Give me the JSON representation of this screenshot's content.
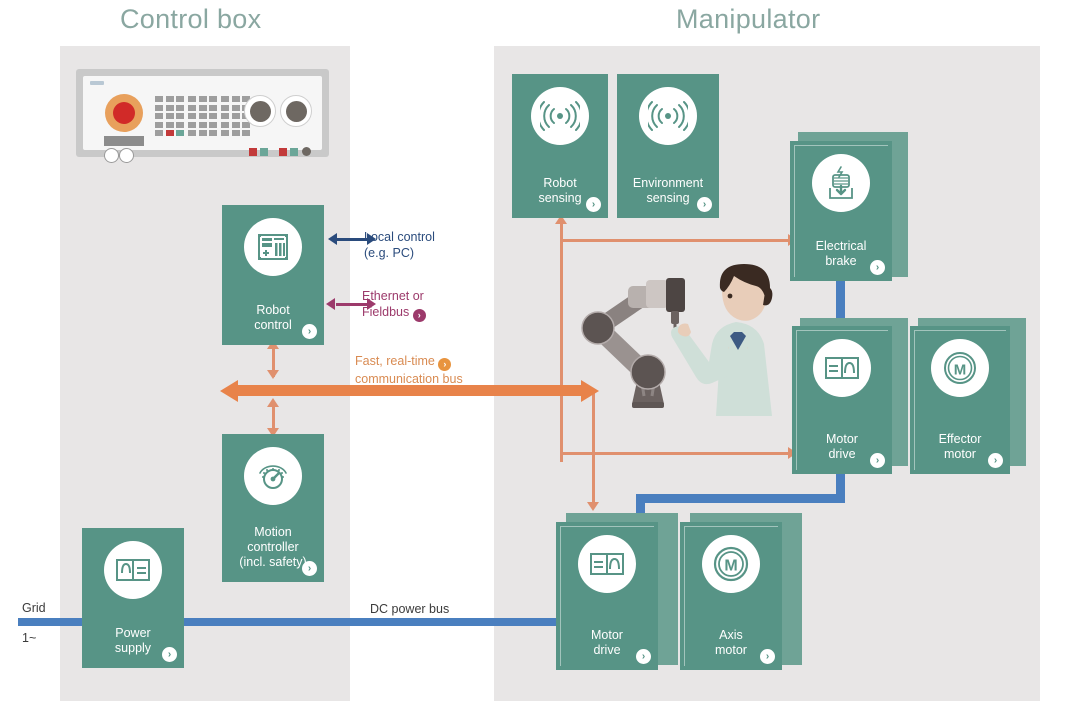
{
  "sections": {
    "control_box": {
      "title": "Control box"
    },
    "manipulator": {
      "title": "Manipulator"
    }
  },
  "blocks": {
    "robot_control": {
      "label": "Robot\ncontrol",
      "icon": "controller-icon",
      "chevron": "›"
    },
    "motion_controller": {
      "label": "Motion\ncontroller\n(incl. safety)",
      "icon": "gauge-icon",
      "chevron": "›"
    },
    "power_supply": {
      "label": "Power\nsupply",
      "icon": "ac-dc-converter-icon",
      "chevron": "›"
    },
    "robot_sensing": {
      "label": "Robot\nsensing",
      "icon": "signal-waves-icon",
      "chevron": "›"
    },
    "environment_sensing": {
      "label": "Environment\nsensing",
      "icon": "signal-waves-icon",
      "chevron": "›"
    },
    "electrical_brake": {
      "label": "Electrical\nbrake",
      "icon": "brake-icon",
      "chevron": "›"
    },
    "motor_drive_upper": {
      "label": "Motor\ndrive",
      "icon": "dc-ac-inverter-icon",
      "chevron": "›"
    },
    "effector_motor": {
      "label": "Effector\nmotor",
      "icon": "motor-m-icon",
      "chevron": "›"
    },
    "motor_drive_lower": {
      "label": "Motor\ndrive",
      "icon": "dc-ac-inverter-icon",
      "chevron": "›"
    },
    "axis_motor": {
      "label": "Axis\nmotor",
      "icon": "motor-m-icon",
      "chevron": "›"
    }
  },
  "captions": {
    "local_control": {
      "line1": "Local control",
      "line2": "(e.g. PC)"
    },
    "ethernet": {
      "line1": "Ethernet or",
      "line2": "Fieldbus",
      "chevron": "›"
    },
    "comm_bus": {
      "line1": "Fast, real-time",
      "line2": "communication bus",
      "chevron": "›"
    },
    "dc_power_bus": {
      "text": "DC power bus"
    },
    "grid": {
      "line1": "Grid",
      "line2": "1~"
    }
  },
  "colors": {
    "block_green": "#579486",
    "panel_gray": "#e8e6e6",
    "title_gray": "#8aa7a1",
    "bus_orange": "#e8834a",
    "bus_blue": "#4a7fbf",
    "caption_blue": "#2a4b7c",
    "caption_purple": "#9c3a6b"
  },
  "scene": {
    "robot_arm": "industrial-robot-arm",
    "operator": "technician-person"
  }
}
